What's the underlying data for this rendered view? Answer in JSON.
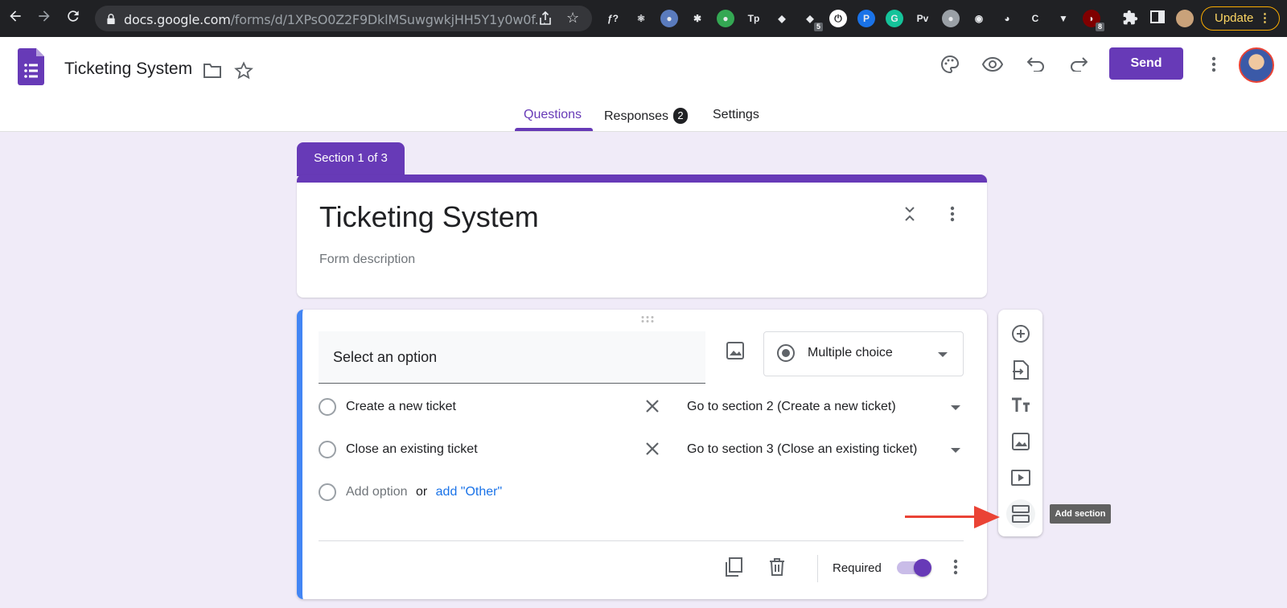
{
  "browser": {
    "url_host": "docs.google.com",
    "url_path": "/forms/d/1XPsO0Z2F9DklMSuwgwkjHH5Y1y0w0f...",
    "update_label": "Update",
    "extensions": [
      {
        "name": "formula-ext",
        "glyph": "ƒ?",
        "color": "transparent",
        "badge": ""
      },
      {
        "name": "react-ext",
        "glyph": "⚛",
        "color": "transparent",
        "badge": ""
      },
      {
        "name": "circle-ext",
        "glyph": "●",
        "color": "#5a7bbd",
        "badge": ""
      },
      {
        "name": "gear-ext",
        "glyph": "✱",
        "color": "transparent",
        "badge": ""
      },
      {
        "name": "green-ext",
        "glyph": "●",
        "color": "#34a853",
        "badge": ""
      },
      {
        "name": "tp-ext",
        "glyph": "Tp",
        "color": "transparent",
        "badge": ""
      },
      {
        "name": "color-ext",
        "glyph": "◆",
        "color": "transparent",
        "badge": ""
      },
      {
        "name": "purple-ext",
        "glyph": "◆",
        "color": "transparent",
        "badge": "5"
      },
      {
        "name": "power-ext",
        "glyph": "⏻",
        "color": "#ffffff",
        "badge": ""
      },
      {
        "name": "p-ext",
        "glyph": "P",
        "color": "#1a73e8",
        "badge": ""
      },
      {
        "name": "grammarly-ext",
        "glyph": "G",
        "color": "#15c39a",
        "badge": ""
      },
      {
        "name": "pv-ext",
        "glyph": "Pv",
        "color": "transparent",
        "badge": ""
      },
      {
        "name": "gray-dot-ext",
        "glyph": "●",
        "color": "#9aa0a6",
        "badge": ""
      },
      {
        "name": "globe-ext",
        "glyph": "◉",
        "color": "transparent",
        "badge": ""
      },
      {
        "name": "owl-ext",
        "glyph": "◕",
        "color": "transparent",
        "badge": ""
      },
      {
        "name": "c-ext",
        "glyph": "C",
        "color": "transparent",
        "badge": ""
      },
      {
        "name": "v-ext",
        "glyph": "▼",
        "color": "transparent",
        "badge": ""
      },
      {
        "name": "ublock-ext",
        "glyph": "◗",
        "color": "#800000",
        "badge": "8"
      }
    ]
  },
  "header": {
    "doc_title": "Ticketing System",
    "send_label": "Send",
    "tabs": [
      {
        "label": "Questions"
      },
      {
        "label": "Responses",
        "badge": "2"
      },
      {
        "label": "Settings"
      }
    ]
  },
  "section": {
    "label": "Section 1 of 3",
    "title": "Ticketing System",
    "description_placeholder": "Form description"
  },
  "question": {
    "title": "Select an option",
    "type": "Multiple choice",
    "options": [
      {
        "label": "Create a new ticket",
        "goto": "Go to section 2 (Create a new ticket)"
      },
      {
        "label": "Close an existing ticket",
        "goto": "Go to section 3 (Close an existing ticket)"
      }
    ],
    "add_option": "Add option",
    "or_label": "or",
    "add_other": "add \"Other\"",
    "required_label": "Required",
    "required": true
  },
  "toolbar": {
    "tooltip": "Add section"
  },
  "colors": {
    "accent": "#673ab7",
    "background": "#f0ebf8",
    "question_border": "#4285f4",
    "annotation_arrow": "#ea4335"
  }
}
